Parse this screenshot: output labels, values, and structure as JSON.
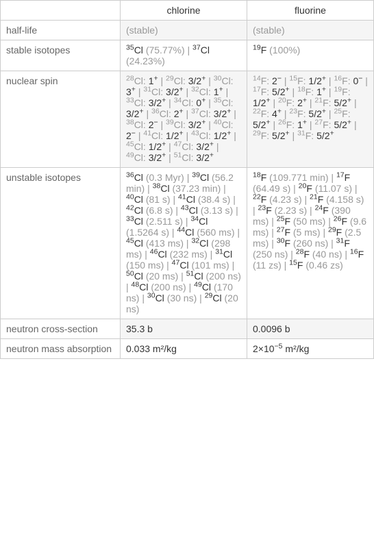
{
  "headers": {
    "chlorine": "chlorine",
    "fluorine": "fluorine"
  },
  "rows": {
    "halflife": {
      "label": "half-life",
      "chlorine": "(stable)",
      "fluorine": "(stable)"
    },
    "stable": {
      "label": "stable isotopes",
      "cl35_sup": "35",
      "cl35_text": "Cl ",
      "cl35_pct": "(75.77%)",
      "sep1": "  |  ",
      "cl37_sup": "37",
      "cl37_text": "Cl ",
      "cl37_pct": "(24.23%)",
      "f19_sup": "19",
      "f19_text": "F ",
      "f19_pct": "(100%)"
    },
    "spin": {
      "label": "nuclear spin"
    },
    "unstable": {
      "label": "unstable isotopes"
    },
    "ncross": {
      "label": "neutron cross-section",
      "chlorine": "35.3 b",
      "fluorine": "0.0096 b"
    },
    "nmass": {
      "label": "neutron mass absorption",
      "chlorine": "0.033 m²/kg",
      "fluorine_pre": "2×10",
      "fluorine_exp": "−5",
      "fluorine_post": " m²/kg"
    }
  },
  "spin_cl": [
    {
      "m": "28",
      "s": "1",
      "p": "+"
    },
    {
      "m": "29",
      "s": "3/2",
      "p": "+"
    },
    {
      "m": "30",
      "s": "3",
      "p": "+"
    },
    {
      "m": "31",
      "s": "3/2",
      "p": "+"
    },
    {
      "m": "32",
      "s": "1",
      "p": "+"
    },
    {
      "m": "33",
      "s": "3/2",
      "p": "+"
    },
    {
      "m": "34",
      "s": "0",
      "p": "+"
    },
    {
      "m": "35",
      "s": "3/2",
      "p": "+"
    },
    {
      "m": "36",
      "s": "2",
      "p": "+"
    },
    {
      "m": "37",
      "s": "3/2",
      "p": "+"
    },
    {
      "m": "38",
      "s": "2",
      "p": "−"
    },
    {
      "m": "39",
      "s": "3/2",
      "p": "+"
    },
    {
      "m": "40",
      "s": "2",
      "p": "−"
    },
    {
      "m": "41",
      "s": "1/2",
      "p": "+"
    },
    {
      "m": "43",
      "s": "1/2",
      "p": "+"
    },
    {
      "m": "45",
      "s": "1/2",
      "p": "+"
    },
    {
      "m": "47",
      "s": "3/2",
      "p": "+"
    },
    {
      "m": "49",
      "s": "3/2",
      "p": "+"
    },
    {
      "m": "51",
      "s": "3/2",
      "p": "+"
    }
  ],
  "spin_f": [
    {
      "m": "14",
      "s": "2",
      "p": "−"
    },
    {
      "m": "15",
      "s": "1/2",
      "p": "+"
    },
    {
      "m": "16",
      "s": "0",
      "p": "−"
    },
    {
      "m": "17",
      "s": "5/2",
      "p": "+"
    },
    {
      "m": "18",
      "s": "1",
      "p": "+"
    },
    {
      "m": "19",
      "s": "1/2",
      "p": "+"
    },
    {
      "m": "20",
      "s": "2",
      "p": "+"
    },
    {
      "m": "21",
      "s": "5/2",
      "p": "+"
    },
    {
      "m": "22",
      "s": "4",
      "p": "+"
    },
    {
      "m": "23",
      "s": "5/2",
      "p": "+"
    },
    {
      "m": "25",
      "s": "5/2",
      "p": "+"
    },
    {
      "m": "26",
      "s": "1",
      "p": "+"
    },
    {
      "m": "27",
      "s": "5/2",
      "p": "+"
    },
    {
      "m": "29",
      "s": "5/2",
      "p": "+"
    },
    {
      "m": "31",
      "s": "5/2",
      "p": "+"
    }
  ],
  "unstable_cl": [
    {
      "m": "36",
      "t": "(0.3 Myr)"
    },
    {
      "m": "39",
      "t": "(56.2 min)"
    },
    {
      "m": "38",
      "t": "(37.23 min)"
    },
    {
      "m": "40",
      "t": "(81 s)"
    },
    {
      "m": "41",
      "t": "(38.4 s)"
    },
    {
      "m": "42",
      "t": "(6.8 s)"
    },
    {
      "m": "43",
      "t": "(3.13 s)"
    },
    {
      "m": "33",
      "t": "(2.511 s)"
    },
    {
      "m": "34",
      "t": "(1.5264 s)"
    },
    {
      "m": "44",
      "t": "(560 ms)"
    },
    {
      "m": "45",
      "t": "(413 ms)"
    },
    {
      "m": "32",
      "t": "(298 ms)"
    },
    {
      "m": "46",
      "t": "(232 ms)"
    },
    {
      "m": "31",
      "t": "(150 ms)"
    },
    {
      "m": "47",
      "t": "(101 ms)"
    },
    {
      "m": "50",
      "t": "(20 ms)"
    },
    {
      "m": "51",
      "t": "(200 ns)"
    },
    {
      "m": "48",
      "t": "(200 ns)"
    },
    {
      "m": "49",
      "t": "(170 ns)"
    },
    {
      "m": "30",
      "t": "(30 ns)"
    },
    {
      "m": "29",
      "t": "(20 ns)"
    }
  ],
  "unstable_f": [
    {
      "m": "18",
      "t": "(109.771 min)"
    },
    {
      "m": "17",
      "t": "(64.49 s)"
    },
    {
      "m": "20",
      "t": "(11.07 s)"
    },
    {
      "m": "22",
      "t": "(4.23 s)"
    },
    {
      "m": "21",
      "t": "(4.158 s)"
    },
    {
      "m": "23",
      "t": "(2.23 s)"
    },
    {
      "m": "24",
      "t": "(390 ms)"
    },
    {
      "m": "25",
      "t": "(50 ms)"
    },
    {
      "m": "26",
      "t": "(9.6 ms)"
    },
    {
      "m": "27",
      "t": "(5 ms)"
    },
    {
      "m": "29",
      "t": "(2.5 ms)"
    },
    {
      "m": "30",
      "t": "(260 ns)"
    },
    {
      "m": "31",
      "t": "(250 ns)"
    },
    {
      "m": "28",
      "t": "(40 ns)"
    },
    {
      "m": "16",
      "t": "(11 zs)"
    },
    {
      "m": "15",
      "t": "(0.46 zs)"
    }
  ],
  "sep": "  |  ",
  "el_cl": "Cl",
  "el_f": "F",
  "colon": ":   "
}
